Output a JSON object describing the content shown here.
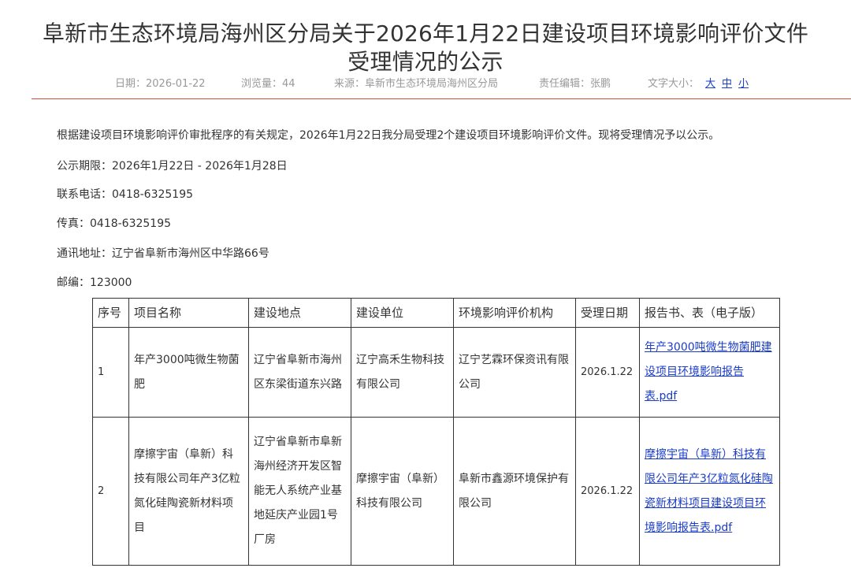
{
  "title": {
    "line1": "阜新市生态环境局海州区分局关于2026年1月22日建设项目环境影响评价文件",
    "line2": "受理情况的公示"
  },
  "meta": {
    "date": "日期：2026-01-22",
    "views": "浏览量：44",
    "source": "来源：阜新市生态环境局海州区分局",
    "editor": "责任编辑：张鹏",
    "font_size_label": "文字大小：",
    "font_large": "大",
    "font_medium": "中",
    "font_small": "小"
  },
  "body": {
    "intro": "根据建设项目环境影响评价审批程序的有关规定，2026年1月22日我分局受理2个建设项目环境影响评价文件。现将受理情况予以公示。",
    "period": "公示期限：2026年1月22日 - 2026年1月28日",
    "phone": "联系电话：0418-6325195",
    "fax": "传真：0418-6325195",
    "address": "通讯地址：辽宁省阜新市海州区中华路66号",
    "zip": "邮编：123000"
  },
  "table": {
    "headers": [
      "序号",
      "项目名称",
      "建设地点",
      "建设单位",
      "环境影响评价机构",
      "受理日期",
      "报告书、表（电子版）"
    ],
    "rows": [
      {
        "no": "1",
        "name": "年产3000吨微生物菌肥",
        "location": "辽宁省阜新市海州区东梁街道东兴路",
        "unit": "辽宁高禾生物科技有限公司",
        "agency": "辽宁艺霖环保资讯有限公司",
        "date": "2026.1.22",
        "report": "年产3000吨微生物菌肥建设项目环境影响报告表.pdf"
      },
      {
        "no": "2",
        "name": "摩擦宇宙（阜新）科技有限公司年产3亿粒氮化硅陶瓷新材料项目",
        "location": "辽宁省阜新市阜新海州经济开发区智能无人系统产业基地延庆产业园1号厂房",
        "unit": "摩擦宇宙（阜新）科技有限公司",
        "agency": "阜新市鑫源环境保护有限公司",
        "date": "2026.1.22",
        "report": "摩擦宇宙（阜新）科技有限公司年产3亿粒氮化硅陶瓷新材料项目建设项目环境影响报告表.pdf"
      }
    ]
  },
  "colors": {
    "divider": "#d94a3b",
    "link": "#1a3cc8",
    "meta_text": "#999999"
  }
}
